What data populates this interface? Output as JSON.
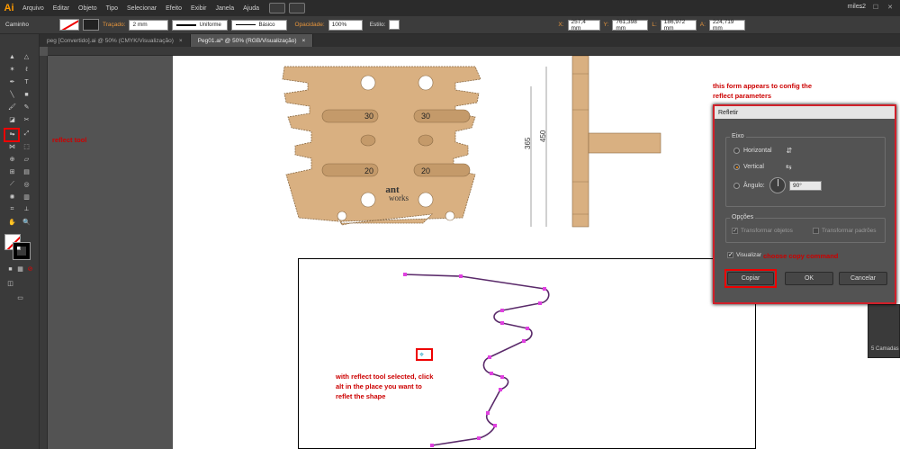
{
  "menubar": {
    "logo": "Ai",
    "items": [
      "Arquivo",
      "Editar",
      "Objeto",
      "Tipo",
      "Selecionar",
      "Efeito",
      "Exibir",
      "Janela",
      "Ajuda"
    ],
    "user": "miles2",
    "window_controls": "— ☐ ✕"
  },
  "controlbar": {
    "selection_label": "Caminho",
    "stroke_label": "Traçado:",
    "stroke_weight": "2 mm",
    "profile": "Uniforme",
    "brush": "Básico",
    "opacity_label": "Opacidade:",
    "opacity": "100%",
    "style_label": "Estilo:",
    "x_label": "X:",
    "x": "257,4 mm",
    "y_label": "Y:",
    "y": "761,398 mm",
    "w_label": "L:",
    "w": "186,972 mm",
    "h_label": "A:",
    "h": "224,719 mm"
  },
  "tabs": [
    {
      "label": "peg [Convertido].ai @ 50% (CMYK/Visualização)",
      "close": "×"
    },
    {
      "label": "Peg01.ai* @ 50% (RGB/Visualização)",
      "close": "×"
    }
  ],
  "artwork": {
    "labels": [
      "30",
      "30",
      "20",
      "20"
    ],
    "brand_top": "ant",
    "brand_bottom": "works",
    "dim_365": "365",
    "dim_450": "450"
  },
  "annotations": {
    "reflect_tool": "reflect tool",
    "form_note_l1": "this form appears to config the",
    "form_note_l2": "reflect parameters",
    "alt_click_l1": "with reflect tool selected, click",
    "alt_click_l2": "alt in the place you want to",
    "alt_click_l3": "reflet the shape",
    "copy_note": "choose copy command"
  },
  "dialog": {
    "title": "Refletir",
    "axis_group": "Eixo",
    "horizontal": "Horizontal",
    "vertical": "Vertical",
    "angle_label": "Ângulo:",
    "angle_value": "90°",
    "options_group": "Opções",
    "transform_objects": "Transformar objetos",
    "transform_patterns": "Transformar padrões",
    "preview": "Visualizar",
    "copy_button": "Copiar",
    "ok_button": "OK",
    "cancel_button": "Cancelar",
    "selected_axis": "vertical"
  },
  "layers_panel": {
    "label": "5 Camadas"
  },
  "colors": {
    "accent": "#ff9a00",
    "annotation": "#cc0000",
    "wood": "#d9b081",
    "path": "#5a2a6a",
    "anchor": "#e040e0"
  }
}
